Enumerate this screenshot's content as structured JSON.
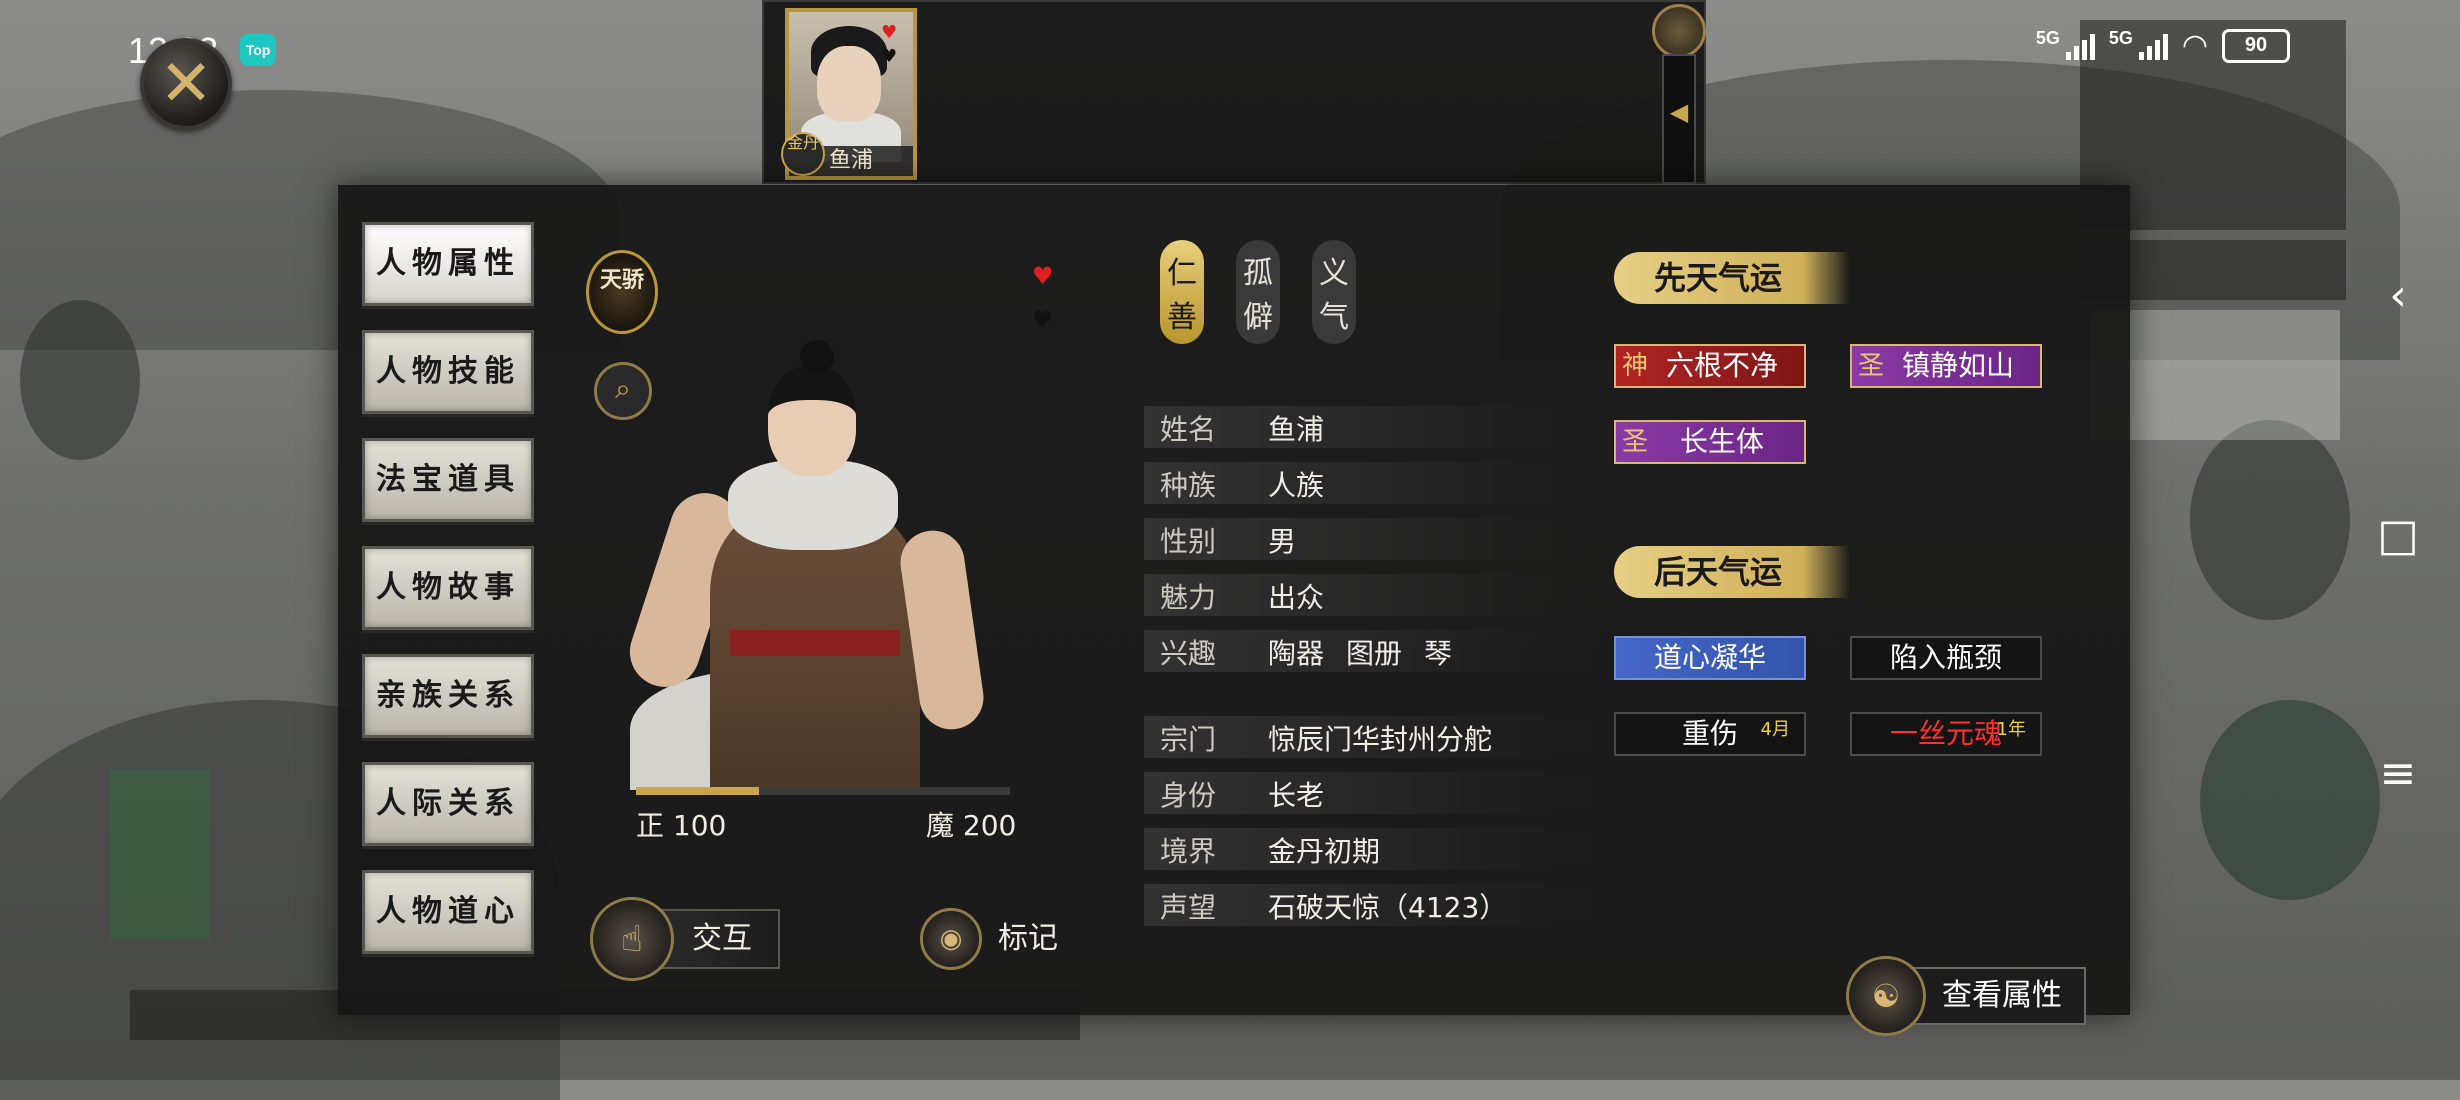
{
  "status_bar": {
    "time": "12:23",
    "app_badge": "Top",
    "network_1": "5G",
    "network_2": "5G",
    "battery": "90"
  },
  "top_card": {
    "rank": "金丹",
    "name": "鱼浦"
  },
  "side_tabs": [
    {
      "label": "人物属性"
    },
    {
      "label": "人物技能"
    },
    {
      "label": "法宝道具"
    },
    {
      "label": "人物故事"
    },
    {
      "label": "亲族关系"
    },
    {
      "label": "人际关系"
    },
    {
      "label": "人物道心"
    }
  ],
  "talent_seal": "天骄",
  "traits": [
    {
      "top": "仁",
      "bottom": "善",
      "style": "gold"
    },
    {
      "top": "孤",
      "bottom": "僻",
      "style": "dark"
    },
    {
      "top": "义",
      "bottom": "气",
      "style": "dark"
    }
  ],
  "alignment": {
    "good_label": "正 100",
    "evil_label": "魔 200",
    "good_fraction": 0.33
  },
  "info": [
    {
      "key": "姓名",
      "value": "鱼浦"
    },
    {
      "key": "种族",
      "value": "人族"
    },
    {
      "key": "性别",
      "value": "男"
    },
    {
      "key": "魅力",
      "value": "出众"
    },
    {
      "key": "兴趣",
      "values": [
        "陶器",
        "图册",
        "琴"
      ]
    },
    {
      "key": "宗门",
      "value": "惊辰门华封州分舵"
    },
    {
      "key": "身份",
      "value": "长老"
    },
    {
      "key": "境界",
      "value": "金丹初期"
    },
    {
      "key": "声望",
      "value": "石破天惊（4123）"
    }
  ],
  "innate_fortune": {
    "title": "先天气运",
    "tags": [
      {
        "glyph": "神",
        "label": "六根不净",
        "color": "red"
      },
      {
        "glyph": "圣",
        "label": "镇静如山",
        "color": "purple"
      },
      {
        "glyph": "圣",
        "label": "长生体",
        "color": "purple"
      }
    ]
  },
  "acquired_fortune": {
    "title": "后天气运",
    "tags": [
      {
        "label": "道心凝华",
        "color": "blue"
      },
      {
        "label": "陷入瓶颈",
        "color": "dark"
      },
      {
        "label": "重伤",
        "duration": "4月",
        "color": "dark"
      },
      {
        "label": "一丝元魂",
        "duration": "1年",
        "color": "dark-red"
      }
    ]
  },
  "actions": {
    "interact": "交互",
    "mark": "标记",
    "view_attributes": "查看属性"
  },
  "colors": {
    "gold": "#c9a64a",
    "panel": "#161616",
    "red_tag": "#b02424",
    "purple_tag": "#8a3aa4",
    "blue_tag": "#4466c8"
  },
  "icons": [
    "close-icon",
    "search-icon",
    "heart-icon",
    "hand-icon",
    "eye-icon",
    "meditate-icon",
    "back-arrow-icon",
    "recent-apps-icon",
    "menu-icon"
  ]
}
